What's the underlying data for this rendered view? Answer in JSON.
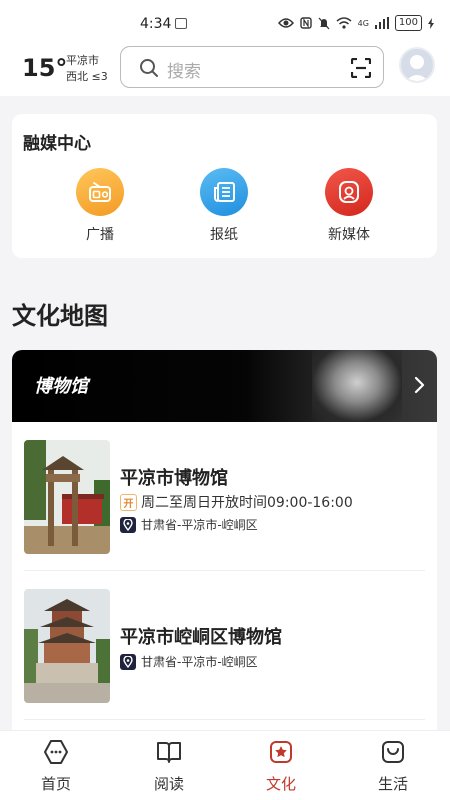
{
  "status_bar": {
    "time": "4:34",
    "network": "4G",
    "battery": "100"
  },
  "header": {
    "weather": {
      "temp": "15°",
      "city": "平凉市",
      "wind": "西北 ≤3"
    },
    "search": {
      "placeholder": "搜索"
    }
  },
  "rongmei": {
    "title": "融媒中心",
    "items": [
      {
        "label": "广播",
        "icon": "radio-icon",
        "color": "#f6a631"
      },
      {
        "label": "报纸",
        "icon": "newspaper-icon",
        "color": "#2f9ee9"
      },
      {
        "label": "新媒体",
        "icon": "new-media-icon",
        "color": "#e03a2f"
      }
    ]
  },
  "culture_map": {
    "title": "文化地图",
    "banner_title": "博物馆",
    "museums": [
      {
        "name": "平凉市博物馆",
        "open_badge": "开",
        "hours": "周二至周日开放时间09:00-16:00",
        "address": "甘肃省-平凉市-崆峒区"
      },
      {
        "name": "平凉市崆峒区博物馆",
        "address": "甘肃省-平凉市-崆峒区"
      }
    ]
  },
  "bottom_nav": {
    "active_color": "#c0392b",
    "tabs": [
      {
        "label": "首页",
        "icon": "home-icon"
      },
      {
        "label": "阅读",
        "icon": "book-icon"
      },
      {
        "label": "文化",
        "icon": "culture-icon",
        "active": true
      },
      {
        "label": "生活",
        "icon": "life-bag-icon"
      }
    ]
  }
}
